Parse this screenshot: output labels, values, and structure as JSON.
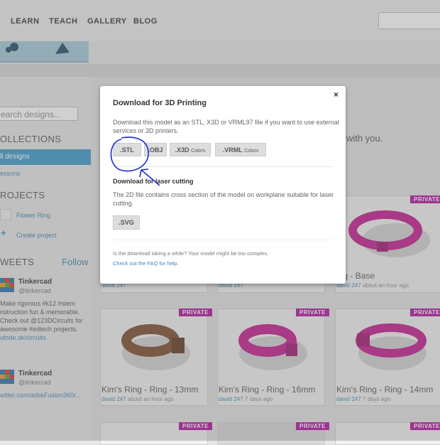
{
  "nav": {
    "items": [
      "LEARN",
      "TEACH",
      "GALLERY",
      "BLOG"
    ]
  },
  "sidebar": {
    "search_placeholder": "earch designs...",
    "collections_heading": "OLLECTIONS",
    "collection_items": [
      "ll designs",
      "essons"
    ],
    "projects_heading": "ROJECTS",
    "project_items": [
      "Flower Ring",
      "Create project"
    ],
    "tweets_heading": "WEETS",
    "follow_label": "Follow",
    "tweets": [
      {
        "name": "Tinkercad",
        "handle": "@tinkercad",
        "lines": [
          "Make rigorous #k12 #stem",
          "nstruction fun & memorable.",
          "Check out @123DCircuits for",
          "awesome #edtech projects.",
          "utode.sk/circuits"
        ]
      },
      {
        "name": "Tinkercad",
        "handle": "@tinkercad",
        "lines": [
          "witter.com/adskFusion360/..."
        ]
      }
    ]
  },
  "main": {
    "intro_text": "with you.",
    "cards": [
      {
        "title": "ing - Base",
        "author": "david 247",
        "time": "about an hour ago",
        "badge": "PRIVATE",
        "color": "#c21a8e"
      },
      {
        "title": "Kim's Ring - Ring - 13mm",
        "author": "david 247",
        "time": "about an hour ago",
        "badge": "PRIVATE",
        "color": "#7a4a2a"
      },
      {
        "title": "Kim's Ring - Ring - 16mm",
        "author": "david 247",
        "time": "7 days ago",
        "badge": "PRIVATE",
        "color": "#c21a8e"
      },
      {
        "title": "Kim's Ring - Ring - 14mm",
        "author": "david 247",
        "time": "7 days ago",
        "badge": "PRIVATE",
        "color": "#c21a8e"
      }
    ],
    "partial_meta": [
      "david 247",
      "david 247"
    ],
    "bottom_badges": [
      "PRIVATE",
      "PRIVATE",
      "PRIVATE"
    ]
  },
  "modal": {
    "title": "Download for 3D Printing",
    "close_label": "×",
    "print_description": "Download this model as an STL, X3D or VRML97 file if you want to use external services or 3D printers.",
    "formats": [
      {
        "label": ".STL",
        "suffix": ""
      },
      {
        "label": ".OBJ",
        "suffix": ""
      },
      {
        "label": ".X3D",
        "suffix": "Colors"
      },
      {
        "label": ".VRML",
        "suffix": "Colors"
      }
    ],
    "laser_title": "Download for laser cutting",
    "laser_description": "The 2D file contains cross section of the model on workplane suitable for laser cutting.",
    "svg_label": ".SVG",
    "wait_text": "Is the download taking a while? Your model might be too complex.",
    "faq_link": "Check out the FAQ for help."
  },
  "colors": {
    "accent": "#3d9ac9",
    "private_badge": "#b30f9e",
    "annotation_ink": "#1a2bd6"
  }
}
